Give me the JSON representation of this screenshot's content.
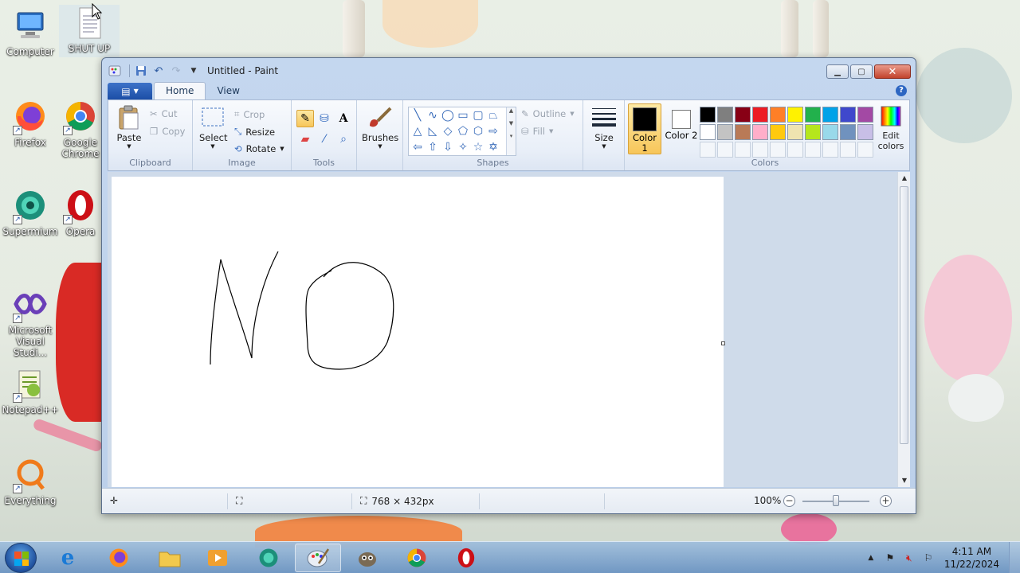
{
  "desktop": {
    "icons": [
      {
        "label": "Computer",
        "icon": "computer-icon"
      },
      {
        "label": "SHUT UP",
        "icon": "text-file-icon"
      },
      {
        "label": "Firefox",
        "icon": "firefox-icon"
      },
      {
        "label": "Google Chrome",
        "icon": "chrome-icon"
      },
      {
        "label": "Supermium",
        "icon": "supermium-icon"
      },
      {
        "label": "Opera",
        "icon": "opera-icon"
      },
      {
        "label": "Microsoft Visual Studi...",
        "icon": "visual-studio-icon"
      },
      {
        "label": "Notepad++",
        "icon": "notepadpp-icon"
      },
      {
        "label": "Everything",
        "icon": "everything-icon"
      }
    ]
  },
  "window": {
    "title": "Untitled - Paint",
    "tabs": [
      "Home",
      "View"
    ],
    "active_tab": "Home"
  },
  "ribbon": {
    "clipboard": {
      "paste": "Paste",
      "cut": "Cut",
      "copy": "Copy",
      "label": "Clipboard"
    },
    "image": {
      "select": "Select",
      "crop": "Crop",
      "resize": "Resize",
      "rotate": "Rotate",
      "label": "Image"
    },
    "tools": {
      "label": "Tools"
    },
    "brushes": {
      "label": "Brushes"
    },
    "shapes": {
      "outline": "Outline",
      "fill": "Fill",
      "label": "Shapes"
    },
    "size": {
      "label": "Size"
    },
    "colors": {
      "color1": "Color 1",
      "color2": "Color 2",
      "edit": "Edit colors",
      "label": "Colors",
      "color1_value": "#000000",
      "color2_value": "#ffffff",
      "palette_row1": [
        "#000000",
        "#7f7f7f",
        "#880015",
        "#ed1c24",
        "#ff7f27",
        "#fff200",
        "#22b14c",
        "#00a2e8",
        "#3f48cc",
        "#a349a4"
      ],
      "palette_row2": [
        "#ffffff",
        "#c3c3c3",
        "#b97a57",
        "#ffaec9",
        "#ffc90e",
        "#efe4b0",
        "#b5e61d",
        "#99d9ea",
        "#7092be",
        "#c8bfe7"
      ]
    }
  },
  "statusbar": {
    "canvas_size": "768 × 432px",
    "zoom": "100%"
  },
  "taskbar": {
    "time": "4:11 AM",
    "date": "11/22/2024"
  }
}
